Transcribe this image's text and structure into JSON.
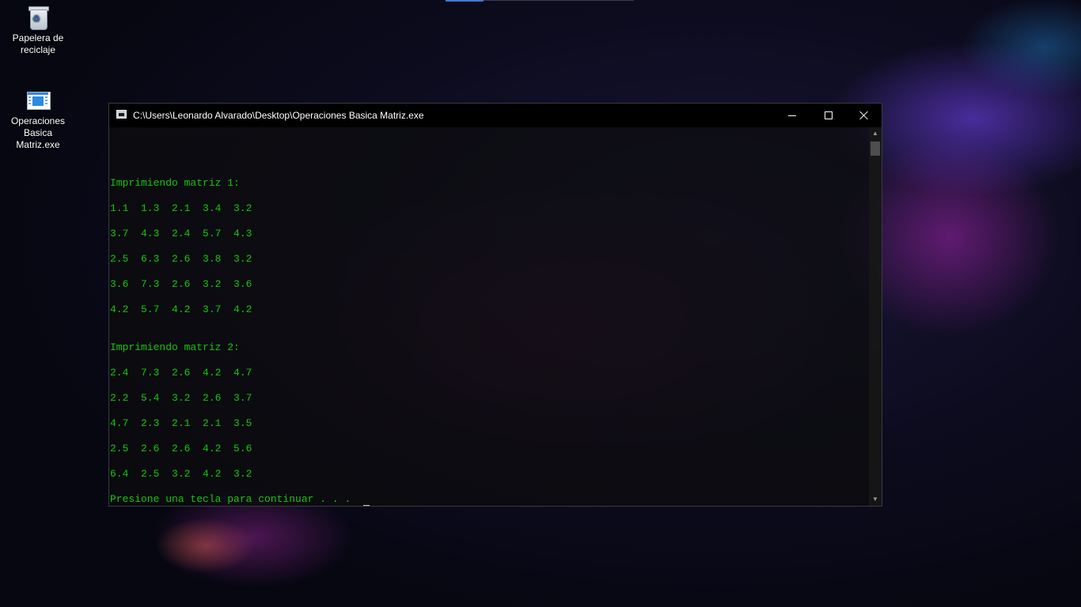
{
  "desktop": {
    "icons": [
      {
        "label_line1": "Papelera de",
        "label_line2": "reciclaje",
        "icon": "recycle-bin-icon"
      },
      {
        "label_line1": "Operaciones",
        "label_line2": "Basica Matriz.exe",
        "icon": "executable-icon"
      }
    ]
  },
  "console": {
    "title": "C:\\Users\\Leonardo Alvarado\\Desktop\\Operaciones Basica Matriz.exe",
    "text_color": "#16c60c",
    "lines": {
      "heading1": "Imprimiendo matriz 1:",
      "m1_row1": "1.1  1.3  2.1  3.4  3.2",
      "m1_row2": "3.7  4.3  2.4  5.7  4.3",
      "m1_row3": "2.5  6.3  2.6  3.8  3.2",
      "m1_row4": "3.6  7.3  2.6  3.2  3.6",
      "m1_row5": "4.2  5.7  4.2  3.7  4.2",
      "heading2": "Imprimiendo matriz 2:",
      "m2_row1": "2.4  7.3  2.6  4.2  4.7",
      "m2_row2": "2.2  5.4  3.2  2.6  3.7",
      "m2_row3": "4.7  2.3  2.1  2.1  3.5",
      "m2_row4": "2.5  2.6  2.6  4.2  5.6",
      "m2_row5": "6.4  2.5  3.2  4.2  3.2",
      "prompt": "Presione una tecla para continuar . . . "
    },
    "controls": {
      "minimize_icon": "minimize-icon",
      "maximize_icon": "maximize-icon",
      "close_icon": "close-icon"
    }
  }
}
